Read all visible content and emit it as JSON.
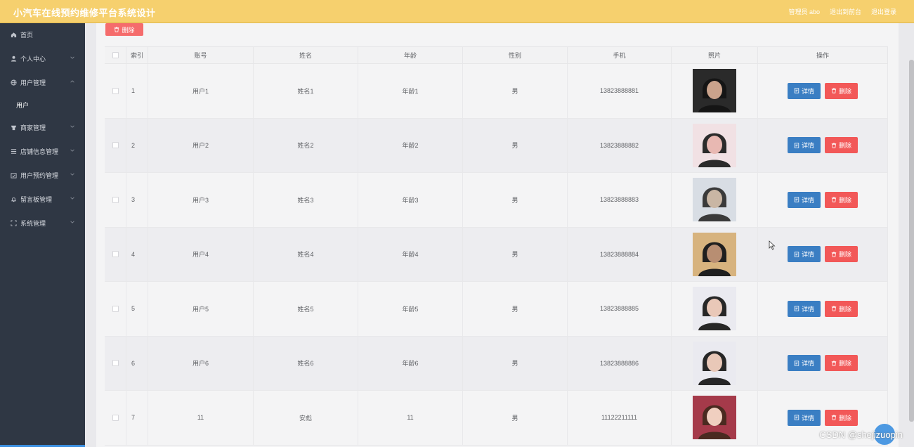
{
  "header": {
    "title": "小汽车在线预约维修平台系统设计",
    "admin_label": "管理员 abo",
    "back_label": "退出到前台",
    "logout_label": "退出登录"
  },
  "sidebar": {
    "items": [
      {
        "label": "首页",
        "icon": "home-icon"
      },
      {
        "label": "个人中心",
        "icon": "user-icon"
      },
      {
        "label": "用户管理",
        "icon": "globe-icon",
        "expanded": true
      },
      {
        "label": "用户",
        "icon": ""
      },
      {
        "label": "商家管理",
        "icon": "shop-icon"
      },
      {
        "label": "店铺信息管理",
        "icon": "list-icon"
      },
      {
        "label": "用户预约管理",
        "icon": "calendar-icon"
      },
      {
        "label": "留言板管理",
        "icon": "bell-icon"
      },
      {
        "label": "系统管理",
        "icon": "frame-icon"
      }
    ]
  },
  "toolbar": {
    "delete_label": "删除"
  },
  "table": {
    "headers": [
      "索引",
      "账号",
      "姓名",
      "年龄",
      "性别",
      "手机",
      "照片",
      "操作"
    ],
    "rows": [
      {
        "index": "1",
        "account": "用户1",
        "name": "姓名1",
        "age": "年龄1",
        "gender": "男",
        "phone": "13823888881"
      },
      {
        "index": "2",
        "account": "用户2",
        "name": "姓名2",
        "age": "年龄2",
        "gender": "男",
        "phone": "13823888882"
      },
      {
        "index": "3",
        "account": "用户3",
        "name": "姓名3",
        "age": "年龄3",
        "gender": "男",
        "phone": "13823888883"
      },
      {
        "index": "4",
        "account": "用户4",
        "name": "姓名4",
        "age": "年龄4",
        "gender": "男",
        "phone": "13823888884"
      },
      {
        "index": "5",
        "account": "用户5",
        "name": "姓名5",
        "age": "年龄5",
        "gender": "男",
        "phone": "13823888885"
      },
      {
        "index": "6",
        "account": "用户6",
        "name": "姓名6",
        "age": "年龄6",
        "gender": "男",
        "phone": "13823888886"
      },
      {
        "index": "7",
        "account": "11",
        "name": "安彪",
        "age": "11",
        "gender": "男",
        "phone": "11122211111"
      }
    ],
    "detail_label": "详情",
    "delete_label": "删除"
  },
  "watermark": "CSDN @shejizuopin",
  "colors": {
    "header": "#f6d06e",
    "sidebar": "#2f3744",
    "detail": "#3a7ec3",
    "delete": "#f25858"
  }
}
